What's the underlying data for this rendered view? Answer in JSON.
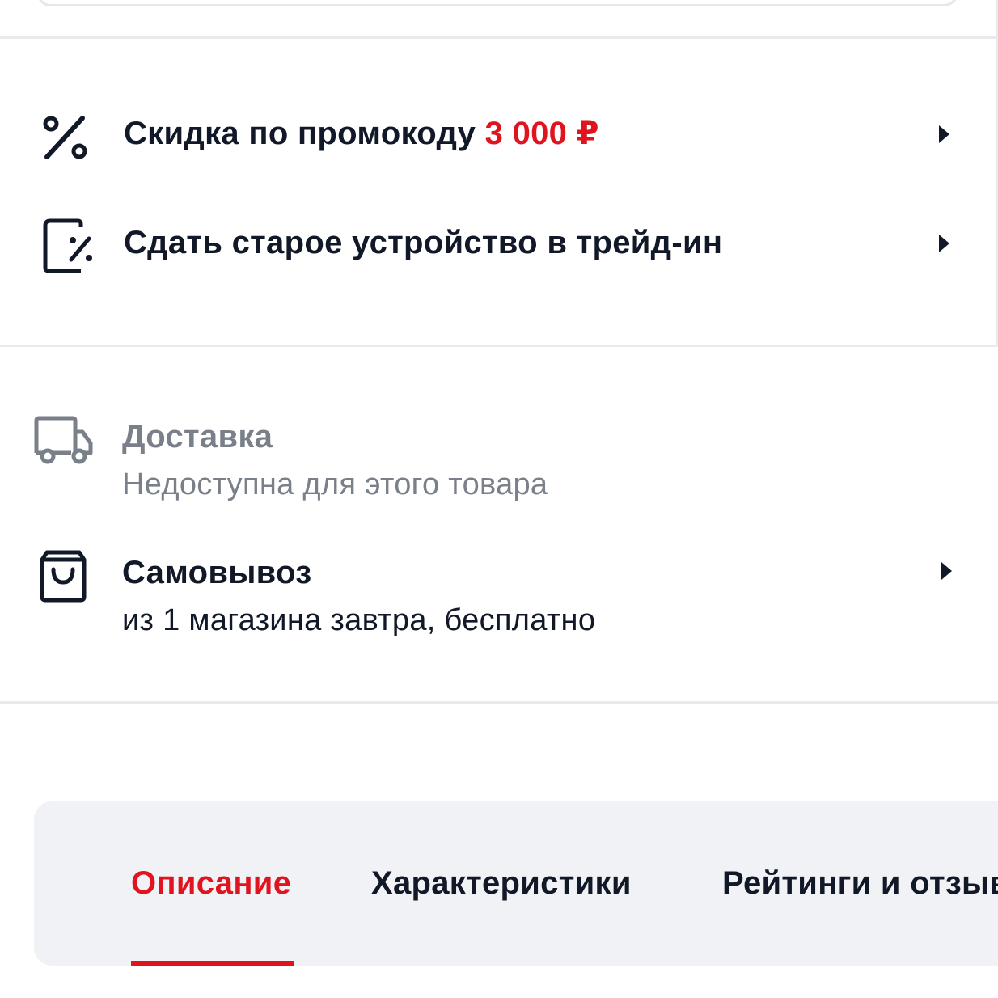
{
  "promo_section": {
    "promo_row": {
      "label": "Скидка по промокоду",
      "amount": "3 000 ₽",
      "icon": "percent-icon"
    },
    "tradein_row": {
      "label": "Сдать старое устройство в трейд-ин",
      "icon": "trade-in-icon"
    }
  },
  "delivery_section": {
    "delivery": {
      "title": "Доставка",
      "subtitle": "Недоступна для этого товара",
      "icon": "truck-icon"
    },
    "pickup": {
      "title": "Самовывоз",
      "subtitle": "из 1 магазина завтра, бесплатно",
      "icon": "shopping-bag-icon"
    }
  },
  "tabs": [
    {
      "label": "Описание",
      "active": true
    },
    {
      "label": "Характеристики",
      "active": false
    },
    {
      "label": "Рейтинги и отзывы",
      "active": false
    }
  ],
  "colors": {
    "accent": "#e0141e",
    "text": "#111827",
    "muted": "#7a8089",
    "panel": "#f1f2f5"
  }
}
